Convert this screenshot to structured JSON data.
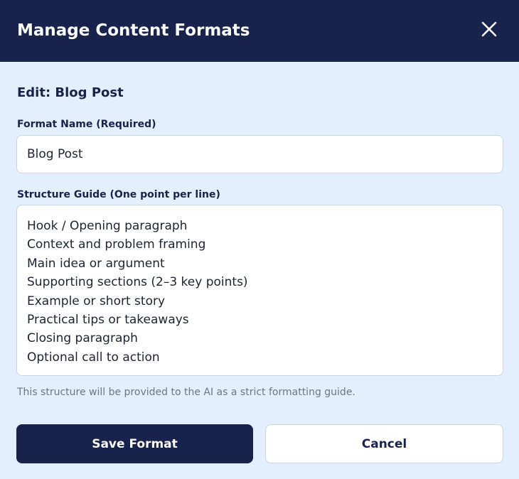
{
  "dialog": {
    "title": "Manage Content Formats",
    "close_icon": "close-icon"
  },
  "form": {
    "section_title": "Edit: Blog Post",
    "name_label": "Format Name (Required)",
    "name_value": "Blog Post",
    "structure_label": "Structure Guide (One point per line)",
    "structure_lines": [
      "Hook / Opening paragraph",
      "Context and problem framing",
      "Main idea or argument",
      "Supporting sections (2–3 key points)",
      "Example or short story",
      "Practical tips or takeaways",
      "Closing paragraph",
      "Optional call to action"
    ],
    "help_text": "This structure will be provided to the AI as a strict formatting guide."
  },
  "actions": {
    "save_label": "Save Format",
    "cancel_label": "Cancel"
  },
  "colors": {
    "header_bg": "#17234b",
    "body_bg": "#e3efff",
    "primary": "#17234b",
    "border": "#c9d5e6",
    "muted_text": "#6b7789"
  }
}
